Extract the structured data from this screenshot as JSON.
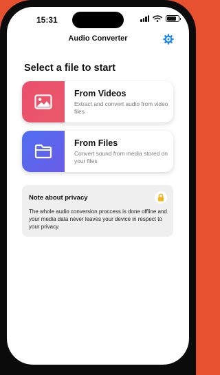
{
  "status_bar": {
    "time": "15:31"
  },
  "nav": {
    "title": "Audio Converter",
    "settings_icon": "gear-icon"
  },
  "main": {
    "heading": "Select a file to start",
    "options": [
      {
        "title": "From Videos",
        "description": "Extract and convert audio from video files",
        "icon": "image-icon",
        "color": "#ec4f6c"
      },
      {
        "title": "From Files",
        "description": "Convert sound from media stored on your files",
        "icon": "folder-icon",
        "color": "#5669ee"
      }
    ]
  },
  "privacy": {
    "title": "Note about privacy",
    "icon": "lock-icon",
    "text": "The whole audio conversion proccess is done offline and your media data never leaves your device in respect to your privacy."
  },
  "colors": {
    "accent": "#1e88e5",
    "background": "#e8512f",
    "lock": "#f2b51f"
  }
}
